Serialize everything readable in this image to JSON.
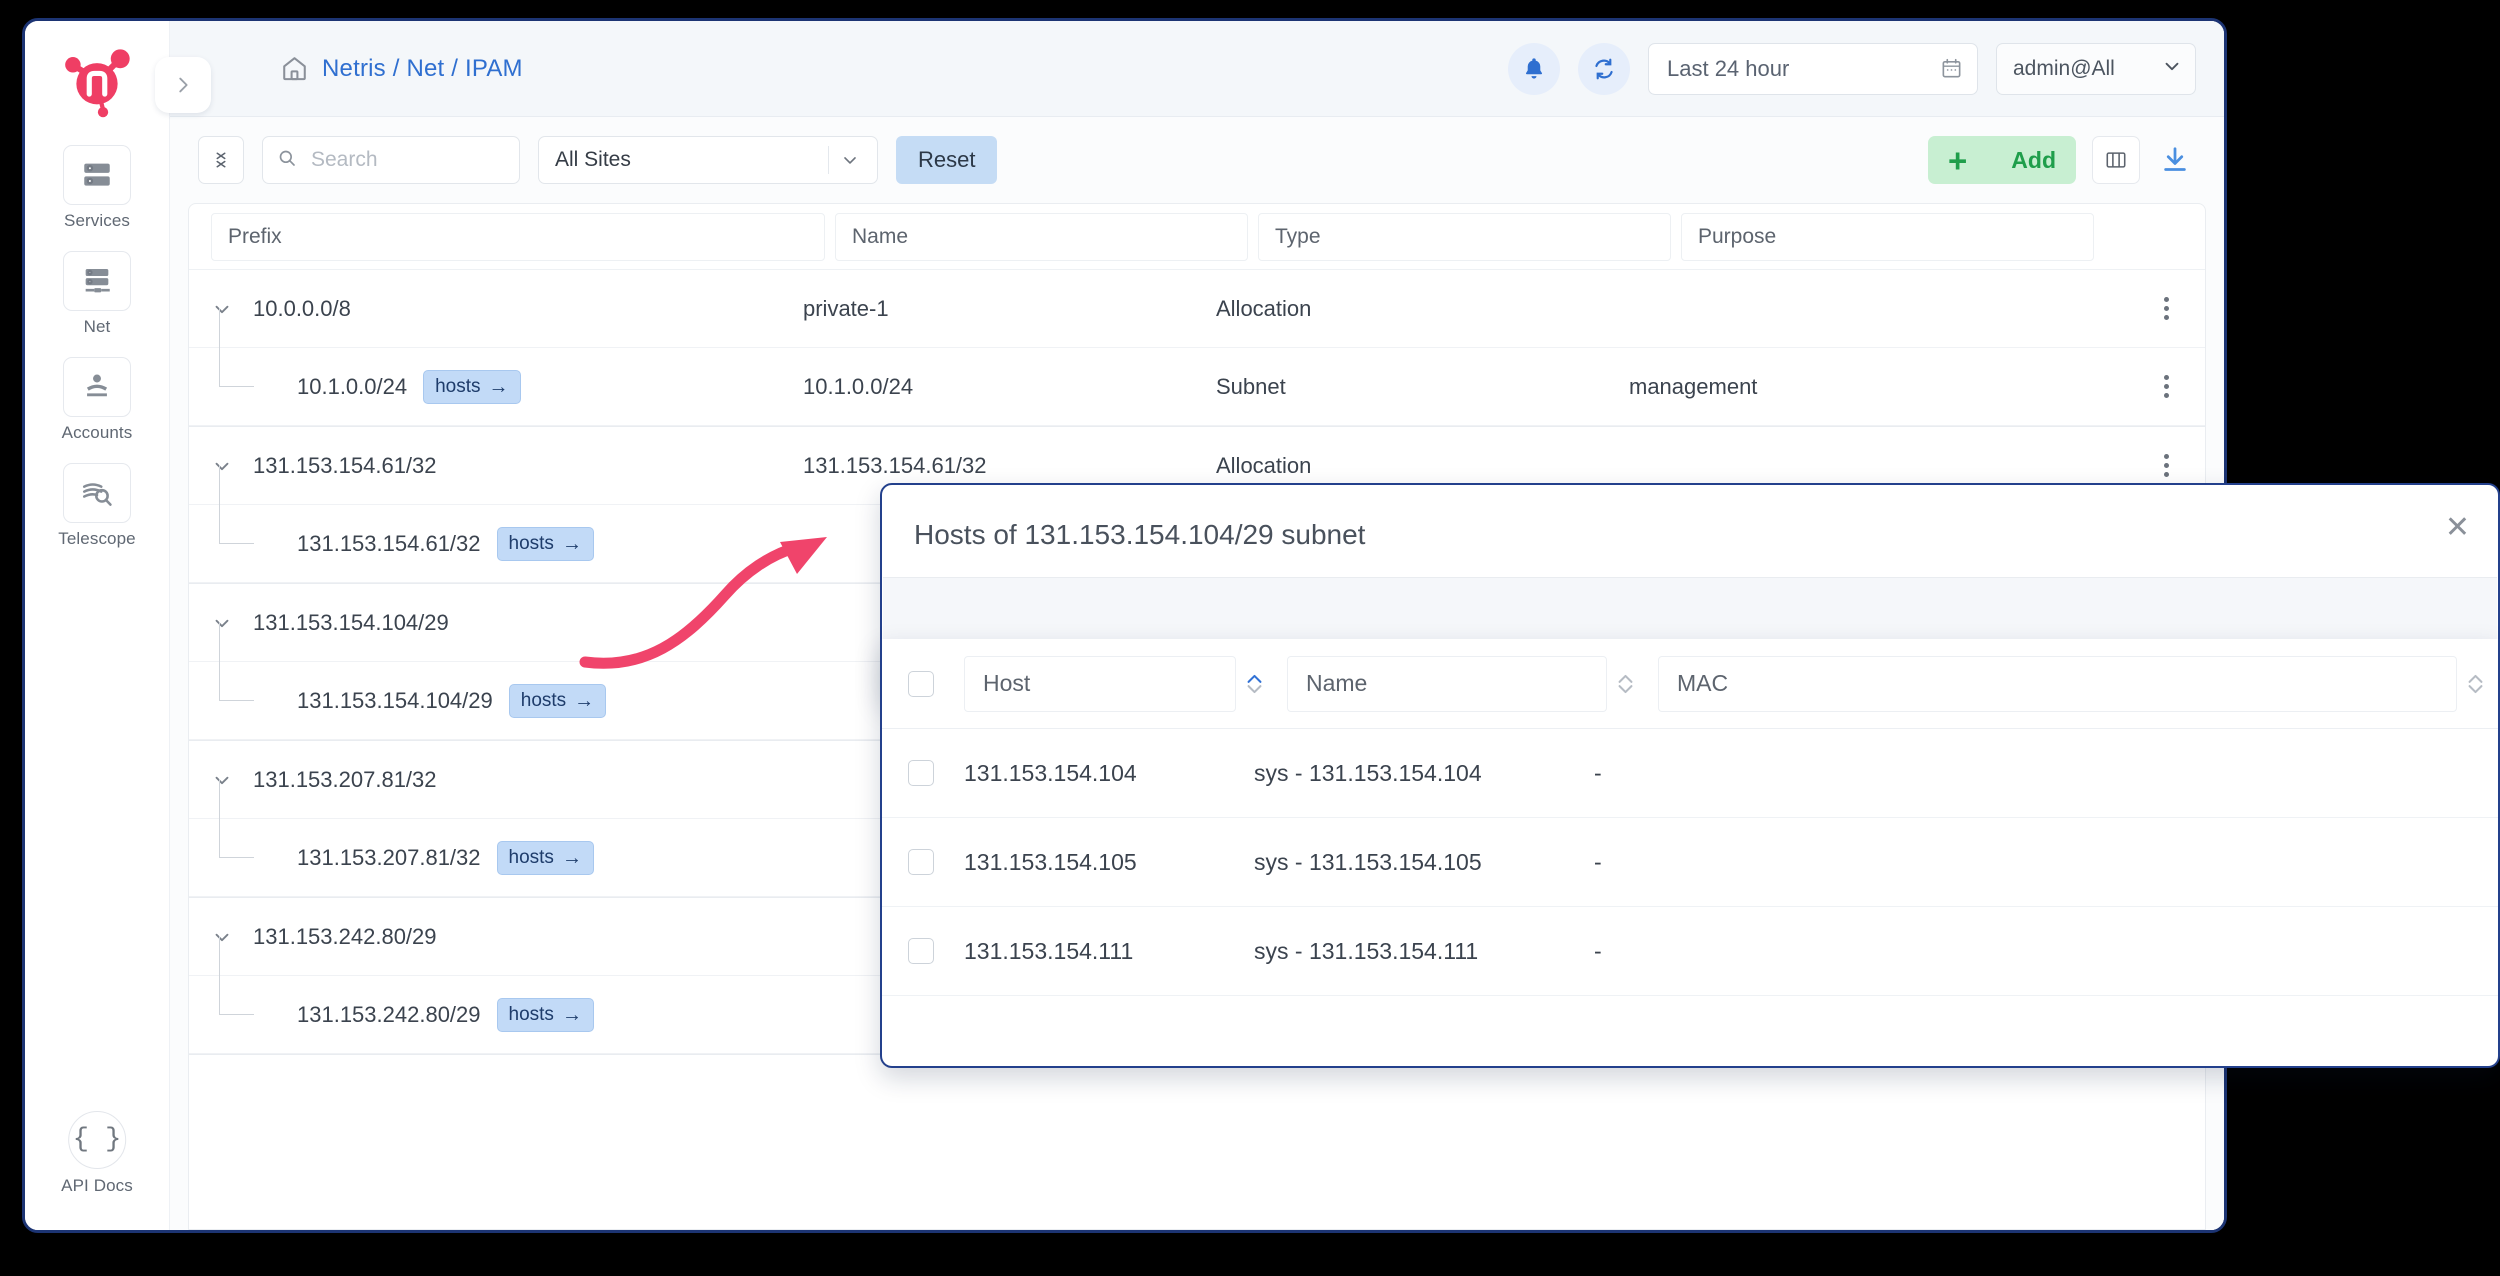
{
  "app": {
    "brand": "netris-logo",
    "sidebar": {
      "items": [
        {
          "label": "Services",
          "icon": "servers-icon"
        },
        {
          "label": "Net",
          "icon": "network-switch-icon"
        },
        {
          "label": "Accounts",
          "icon": "accounts-icon"
        },
        {
          "label": "Telescope",
          "icon": "telescope-search-icon"
        }
      ],
      "api_docs": {
        "label": "API Docs",
        "icon": "braces-icon"
      },
      "toggle_icon": "chevron-right-icon"
    },
    "header": {
      "home_icon": "home-icon",
      "breadcrumb": "Netris / Net / IPAM",
      "notifications_icon": "bell-icon",
      "refresh_icon": "refresh-icon",
      "timerange": {
        "value": "Last 24 hour",
        "icon": "calendar-icon"
      },
      "user": {
        "value": "admin@All",
        "icon": "chevron-down-icon"
      }
    },
    "toolbar": {
      "collapse_icon": "collapse-rows-icon",
      "search": {
        "placeholder": "Search",
        "value": "",
        "icon": "search-icon"
      },
      "site_filter": {
        "value": "All Sites",
        "icon": "chevron-down-icon"
      },
      "reset_label": "Reset",
      "add_label": "Add",
      "add_plus": "+",
      "columns_icon": "columns-layout-icon",
      "download_icon": "download-icon"
    },
    "table": {
      "columns": [
        "Prefix",
        "Name",
        "Type",
        "Purpose"
      ],
      "groups": [
        {
          "prefix": "10.0.0.0/8",
          "name": "private-1",
          "type": "Allocation",
          "purpose": "",
          "children": [
            {
              "prefix": "10.1.0.0/24",
              "badge": "hosts",
              "name": "10.1.0.0/24",
              "type": "Subnet",
              "purpose": "management"
            }
          ]
        },
        {
          "prefix": "131.153.154.61/32",
          "name": "131.153.154.61/32",
          "type": "Allocation",
          "purpose": "",
          "children": [
            {
              "prefix": "131.153.154.61/32",
              "badge": "hosts",
              "name": "",
              "type": "",
              "purpose": ""
            }
          ]
        },
        {
          "prefix": "131.153.154.104/29",
          "name": "",
          "type": "",
          "purpose": "",
          "children": [
            {
              "prefix": "131.153.154.104/29",
              "badge": "hosts",
              "name": "",
              "type": "",
              "purpose": ""
            }
          ]
        },
        {
          "prefix": "131.153.207.81/32",
          "name": "",
          "type": "",
          "purpose": "",
          "children": [
            {
              "prefix": "131.153.207.81/32",
              "badge": "hosts",
              "name": "",
              "type": "",
              "purpose": ""
            }
          ]
        },
        {
          "prefix": "131.153.242.80/29",
          "name": "",
          "type": "",
          "purpose": "",
          "children": [
            {
              "prefix": "131.153.242.80/29",
              "badge": "hosts",
              "name": "",
              "type": "",
              "purpose": ""
            }
          ]
        }
      ]
    },
    "modal": {
      "title": "Hosts of 131.153.154.104/29 subnet",
      "close_icon": "close-icon",
      "columns": [
        "Host",
        "Name",
        "MAC"
      ],
      "sort": {
        "active_column": "Host",
        "direction": "asc"
      },
      "rows": [
        {
          "host": "131.153.154.104",
          "name": "sys - 131.153.154.104",
          "mac": "-"
        },
        {
          "host": "131.153.154.105",
          "name": "sys - 131.153.154.105",
          "mac": "-"
        },
        {
          "host": "131.153.154.111",
          "name": "sys - 131.153.154.111",
          "mac": "-"
        }
      ]
    },
    "annotation": {
      "arrow_color": "#f0446b"
    },
    "colors": {
      "accent_blue": "#2f6fd0",
      "brand_pink": "#ef3e64",
      "window_border": "#1c3473",
      "add_green": "#1f9e4b",
      "badge_blue": "#c2daf7",
      "reset_blue": "#c5dcf5",
      "page_bg": "#f4f7fa"
    }
  }
}
